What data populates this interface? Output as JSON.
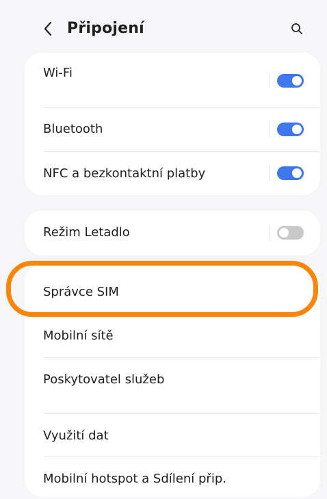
{
  "header": {
    "title": "Připojení",
    "back_icon": "chevron-left-icon",
    "search_icon": "search-icon"
  },
  "connections": {
    "items": [
      {
        "label": "Wi-Fi",
        "toggle": true
      },
      {
        "label": "Bluetooth",
        "toggle": true
      },
      {
        "label": "NFC a bezkontaktní platby",
        "toggle": true
      }
    ]
  },
  "airplane": {
    "label": "Režim Letadlo",
    "toggle": false
  },
  "sim_section": {
    "items": [
      {
        "label": "Správce SIM"
      },
      {
        "label": "Mobilní sítě"
      },
      {
        "label": "Poskytovatel služeb"
      },
      {
        "label": "Využití dat"
      },
      {
        "label": "Mobilní hotspot a Sdílení přip."
      }
    ]
  },
  "colors": {
    "toggle_on": "#3e78ec",
    "toggle_off": "#c9c9cc",
    "highlight": "#fb8507",
    "background": "#f6f6f8",
    "card": "#ffffff"
  }
}
